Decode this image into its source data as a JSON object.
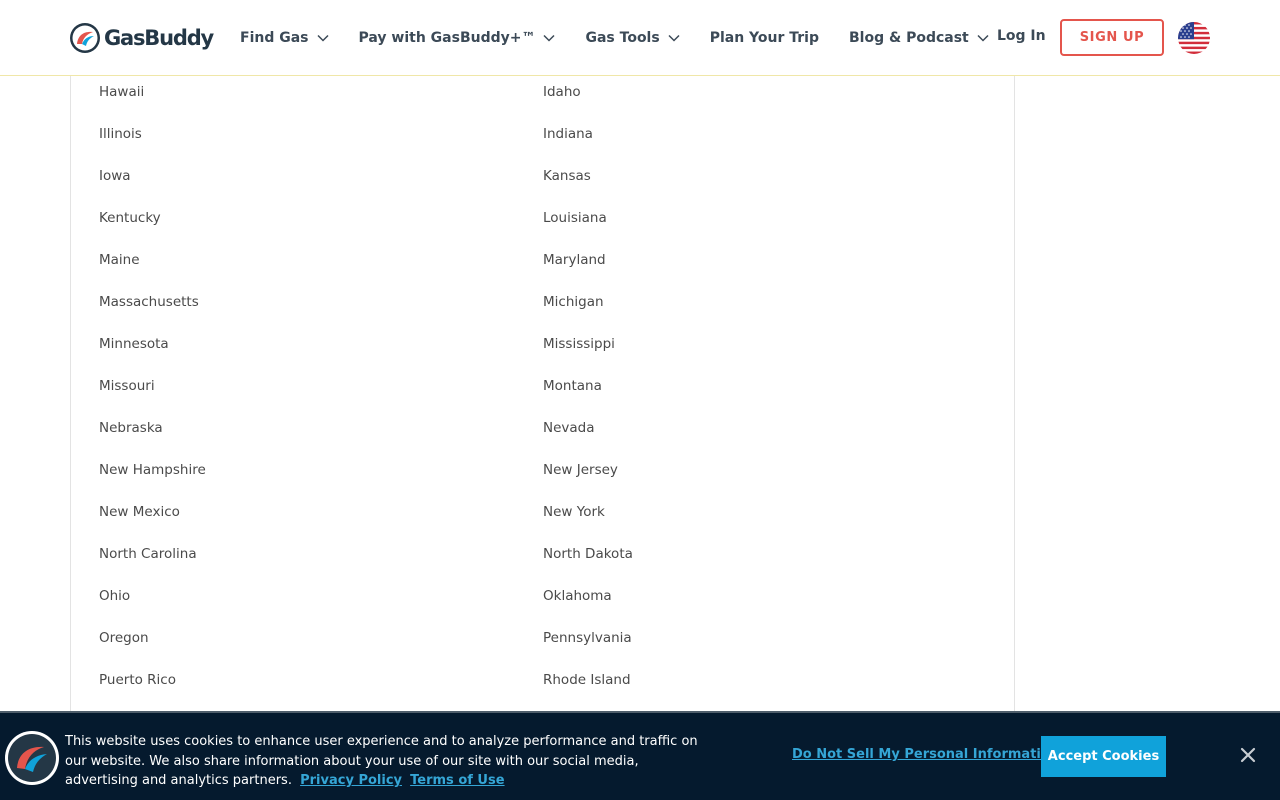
{
  "header": {
    "logo_text": "GasBuddy",
    "nav": [
      {
        "label": "Find Gas",
        "has_dropdown": true
      },
      {
        "label": "Pay with GasBuddy+™",
        "has_dropdown": true
      },
      {
        "label": "Gas Tools",
        "has_dropdown": true
      },
      {
        "label": "Plan Your Trip",
        "has_dropdown": false
      },
      {
        "label": "Blog & Podcast",
        "has_dropdown": true
      }
    ],
    "login_label": "Log In",
    "signup_label": "SIGN UP",
    "flag_icon": "us-flag-icon"
  },
  "states": {
    "left": [
      "Hawaii",
      "Illinois",
      "Iowa",
      "Kentucky",
      "Maine",
      "Massachusetts",
      "Minnesota",
      "Missouri",
      "Nebraska",
      "New Hampshire",
      "New Mexico",
      "North Carolina",
      "Ohio",
      "Oregon",
      "Puerto Rico"
    ],
    "right": [
      "Idaho",
      "Indiana",
      "Kansas",
      "Louisiana",
      "Maryland",
      "Michigan",
      "Mississippi",
      "Montana",
      "Nevada",
      "New Jersey",
      "New York",
      "North Dakota",
      "Oklahoma",
      "Pennsylvania",
      "Rhode Island"
    ]
  },
  "cookie_banner": {
    "text": "This website uses cookies to enhance user experience and to analyze performance and traffic on our website. We also share information about your use of our site with our social media, advertising and analytics partners.",
    "privacy_link": "Privacy Policy",
    "terms_link": "Terms of Use",
    "do_not_sell_label": "Do Not Sell My Personal Information",
    "accept_label": "Accept Cookies"
  },
  "colors": {
    "brand_red": "#e4554c",
    "brand_navy": "#243746",
    "banner_bg": "#051a2e",
    "link_blue": "#35a6d6",
    "accept_bg": "#10a2da"
  }
}
